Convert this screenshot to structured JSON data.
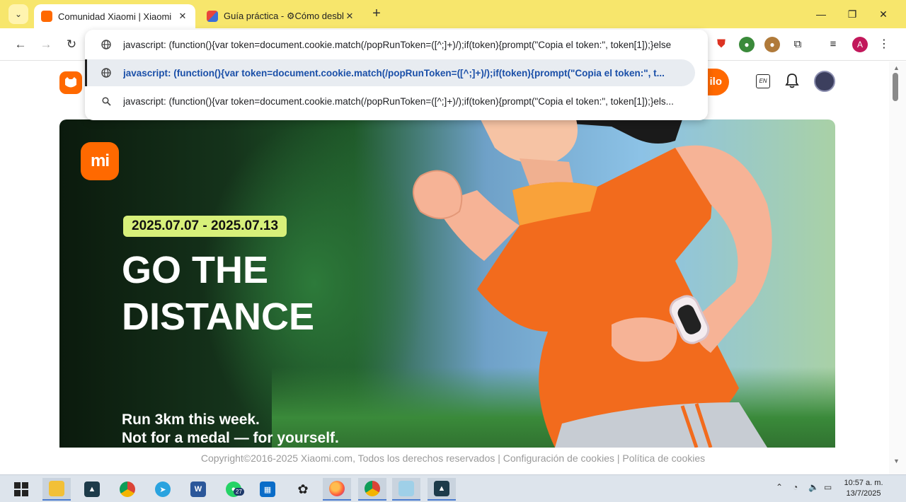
{
  "browser": {
    "tabs": [
      {
        "title": "Comunidad Xiaomi | Xiaomi",
        "active": true,
        "favicon_color": "#ff6900"
      },
      {
        "title": "Guía práctica - ⚙Cómo desblo",
        "active": false,
        "favicon_color": "#e8453c"
      }
    ],
    "new_tab_label": "+",
    "tab_menu_glyph": "⌄",
    "window_controls": {
      "minimize": "—",
      "maximize": "❐",
      "close": "✕"
    },
    "omnibox_input": "javascript: (function(){var token=document.cookie.match(/popRunToken=([^;]+)/);if(token){prompt(\"Copia el token:\", token[1]);}else",
    "suggestions": [
      {
        "text": "javascript: (function(){var token=document.cookie.match(/popRunToken=([^;]+)/);if(token){prompt(\"Copia el token:\", t...",
        "icon": "globe-icon",
        "selected": true
      },
      {
        "text": "javascript: (function(){var token=document.cookie.match(/popRunToken=([^;]+)/);if(token){prompt(\"Copia el token:\", token[1]);}els...",
        "icon": "search-icon",
        "selected": false
      }
    ],
    "profile_initial": "A"
  },
  "header": {
    "logo_text": "🐱",
    "orange_button_label": "ilo",
    "lang_label": "EN"
  },
  "banner": {
    "brand": "mi",
    "date_range": "2025.07.07 - 2025.07.13",
    "headline_1": "GO THE",
    "headline_2": "DISTANCE",
    "sub_1": "Run 3km this week.",
    "sub_2": "Not for a medal — for yourself."
  },
  "footer": {
    "text": "Copyright©2016-2025 Xiaomi.com, Todos los derechos reservados | Configuración de cookies | Política de cookies"
  },
  "taskbar": {
    "badge_count": "27",
    "time": "10:57 a. m.",
    "date": "13/7/2025"
  },
  "colors": {
    "accent": "#ff6900",
    "title_bar": "#f7e66c",
    "pill": "#d7f07a"
  }
}
